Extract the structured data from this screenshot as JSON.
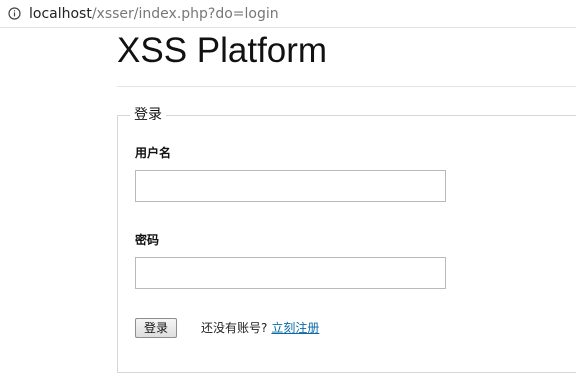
{
  "browser": {
    "url_host": "localhost",
    "url_path": "/xsser/index.php?do=login"
  },
  "page": {
    "title": "XSS Platform"
  },
  "login_form": {
    "legend": "登录",
    "username_label": "用户名",
    "username_value": "",
    "password_label": "密码",
    "password_value": "",
    "submit_label": "登录",
    "no_account_text": "还没有账号?",
    "register_link": "立刻注册"
  },
  "colors": {
    "link": "#0b6aa8",
    "border": "#d6d6d6"
  },
  "icons": {
    "address_bar": "info-icon"
  }
}
